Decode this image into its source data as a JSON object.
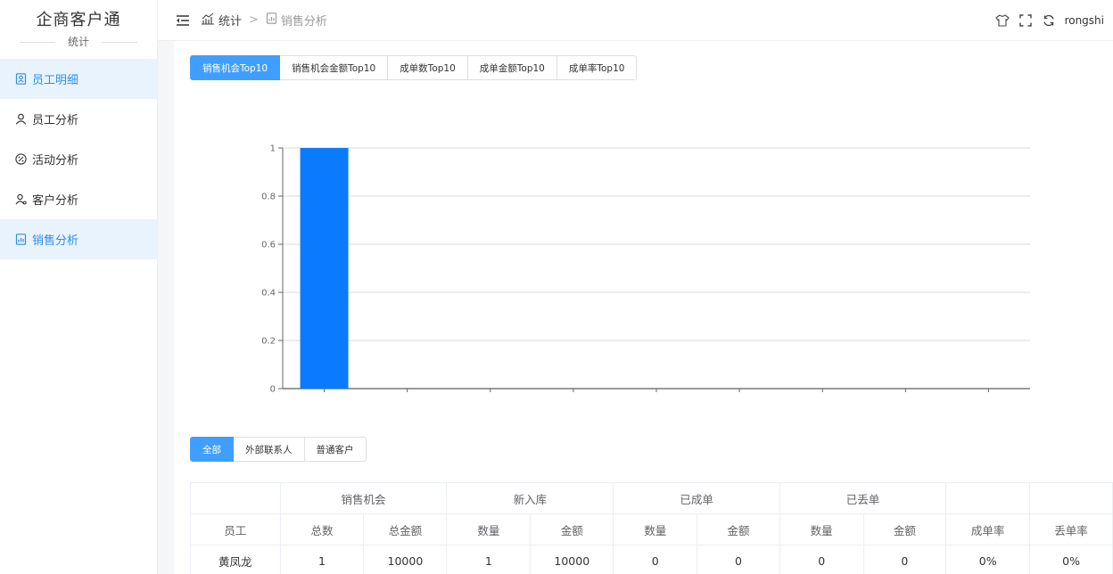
{
  "brand": {
    "title": "企商客户通",
    "subtitle": "统计"
  },
  "sidebar": {
    "items": [
      {
        "label": "员工明细",
        "icon": "person-card-icon",
        "active": true
      },
      {
        "label": "员工分析",
        "icon": "person-icon",
        "active": false
      },
      {
        "label": "活动分析",
        "icon": "percent-icon",
        "active": false
      },
      {
        "label": "客户分析",
        "icon": "customer-icon",
        "active": false
      },
      {
        "label": "销售分析",
        "icon": "report-icon",
        "active": true
      }
    ]
  },
  "topbar": {
    "breadcrumb": [
      {
        "label": "统计"
      },
      {
        "label": "销售分析"
      }
    ],
    "separator": ">",
    "username": "rongshi"
  },
  "tabs": [
    {
      "label": "销售机会Top10",
      "active": true
    },
    {
      "label": "销售机会金额Top10",
      "active": false
    },
    {
      "label": "成单数Top10",
      "active": false
    },
    {
      "label": "成单金额Top10",
      "active": false
    },
    {
      "label": "成单率Top10",
      "active": false
    }
  ],
  "chart_data": {
    "type": "bar",
    "values": [
      1,
      0,
      0,
      0,
      0,
      0,
      0,
      0,
      0
    ],
    "ylim": [
      0,
      1
    ],
    "yticks": [
      "0",
      "0.2",
      "0.4",
      "0.6",
      "0.8",
      "1"
    ],
    "grid": true,
    "bar_color": "#0a7bff"
  },
  "filter_tabs": [
    {
      "label": "全部",
      "active": true
    },
    {
      "label": "外部联系人",
      "active": false
    },
    {
      "label": "普通客户",
      "active": false
    }
  ],
  "table": {
    "groups": [
      "销售机会",
      "新入库",
      "已成单",
      "已丢单"
    ],
    "columns": [
      "员工",
      "总数",
      "总金额",
      "数量",
      "金额",
      "数量",
      "金额",
      "数量",
      "金额",
      "成单率",
      "丢单率"
    ],
    "rows": [
      [
        "黄凤龙",
        "1",
        "10000",
        "1",
        "10000",
        "0",
        "0",
        "0",
        "0",
        "0%",
        "0%"
      ]
    ]
  },
  "colors": {
    "accent": "#409eff",
    "active_bg": "#e8f3fd",
    "active_text": "#2f8ee8"
  }
}
